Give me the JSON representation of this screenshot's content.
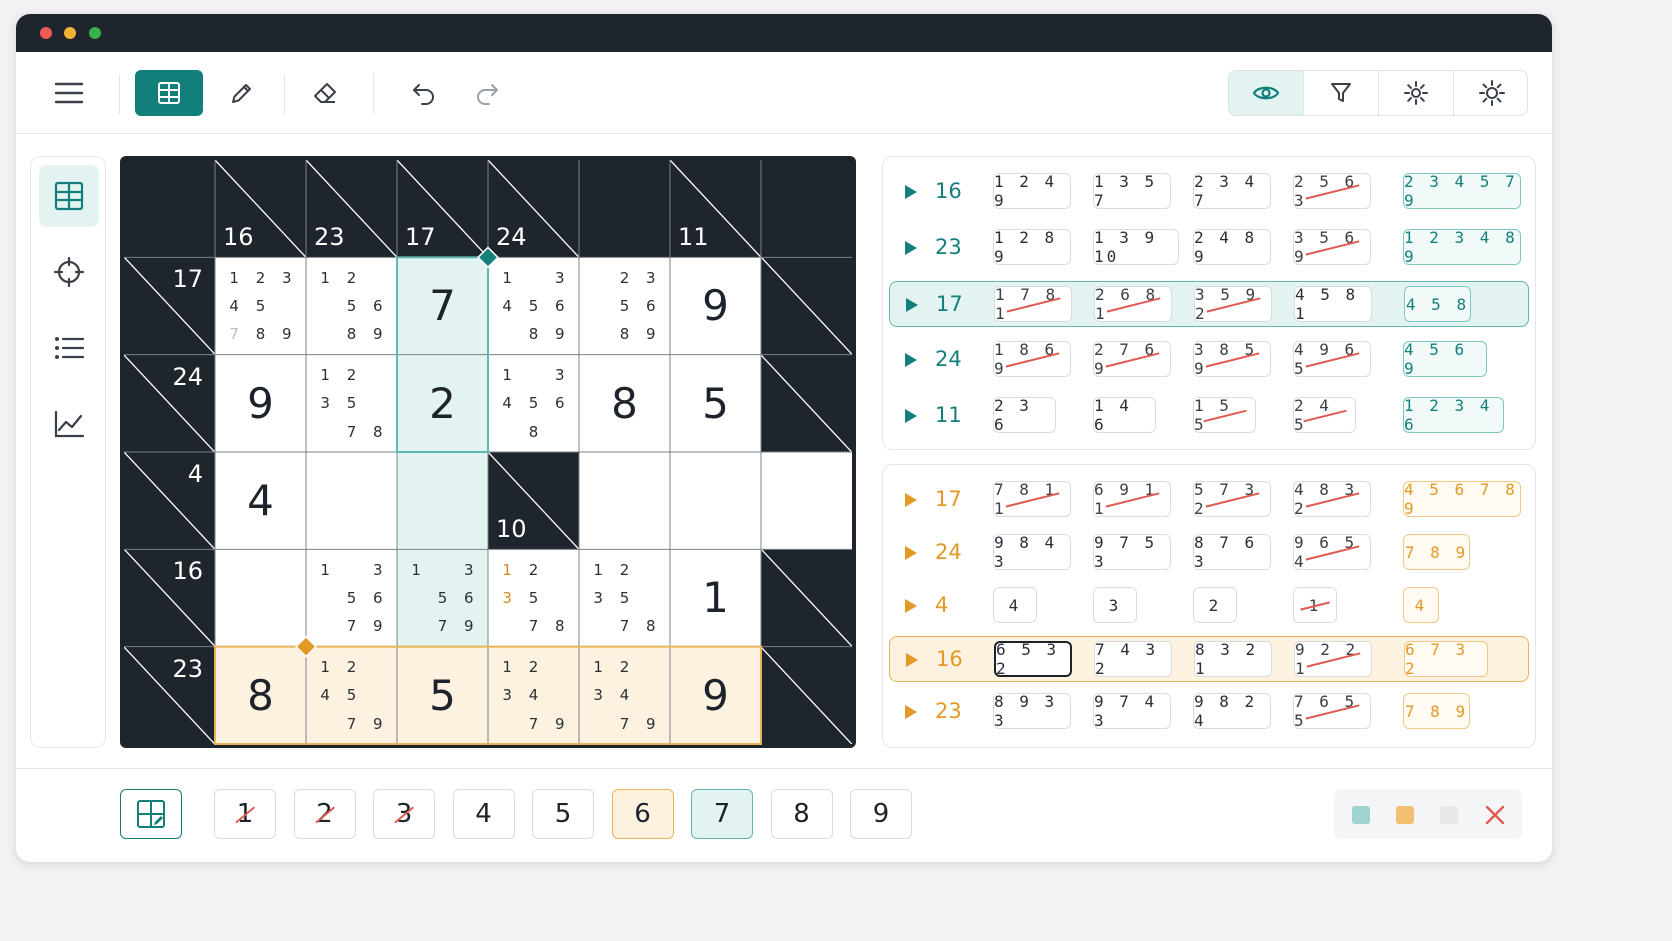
{
  "colors": {
    "teal": "#127f7b",
    "orange": "#e39a25",
    "dark": "#1f252c",
    "teal_light": "#e3f3f1",
    "orange_light": "#fdf1df",
    "strike": "#e05a50"
  },
  "toolbar": {
    "left_icons": [
      "menu-icon",
      "grid-icon",
      "pencil-icon",
      "eraser-icon",
      "undo-icon",
      "redo-icon"
    ],
    "right_icons": [
      "eye-icon",
      "filter-icon",
      "gear-icon",
      "sun-icon"
    ]
  },
  "sidebar": {
    "icons": [
      "grid-icon",
      "crosshair-icon",
      "list-icon",
      "chart-icon"
    ]
  },
  "board": {
    "cols": 8,
    "rows": 6,
    "cells": [
      [
        {
          "t": "b"
        },
        {
          "t": "c",
          "d": "16"
        },
        {
          "t": "c",
          "d": "23"
        },
        {
          "t": "c",
          "d": "17"
        },
        {
          "t": "c",
          "d": "24"
        },
        {
          "t": "b"
        },
        {
          "t": "c",
          "d": "11"
        },
        {
          "t": "b"
        }
      ],
      [
        {
          "t": "c",
          "r": "17"
        },
        {
          "t": "w",
          "n": [
            "1",
            "2",
            "3",
            "4",
            "5",
            "",
            "7",
            "8",
            "9"
          ],
          "dim": [
            6
          ]
        },
        {
          "t": "w",
          "n": [
            "1",
            "2",
            "",
            "",
            "5",
            "6",
            "",
            "8",
            "9"
          ]
        },
        {
          "t": "w",
          "h": "t",
          "v": "7"
        },
        {
          "t": "w",
          "n": [
            "1",
            "",
            "3",
            "4",
            "5",
            "6",
            "",
            "8",
            "9"
          ]
        },
        {
          "t": "w",
          "n": [
            "",
            "2",
            "3",
            "",
            "5",
            "6",
            "",
            "8",
            "9"
          ]
        },
        {
          "t": "w",
          "v": "9"
        },
        {
          "t": "c"
        }
      ],
      [
        {
          "t": "c",
          "r": "24"
        },
        {
          "t": "w",
          "v": "9"
        },
        {
          "t": "w",
          "n": [
            "1",
            "2",
            "",
            "3",
            "5",
            "",
            "",
            "7",
            "8"
          ]
        },
        {
          "t": "w",
          "h": "t",
          "v": "2"
        },
        {
          "t": "w",
          "n": [
            "1",
            "",
            "3",
            "4",
            "5",
            "6",
            "",
            "8",
            ""
          ]
        },
        {
          "t": "w",
          "v": "8"
        },
        {
          "t": "w",
          "v": "5"
        },
        {
          "t": "c"
        }
      ],
      [
        {
          "t": "c",
          "r": "4"
        },
        {
          "t": "w",
          "v": "4"
        },
        {
          "t": "w"
        },
        {
          "t": "w",
          "h": "t"
        },
        {
          "t": "c",
          "d": "10"
        },
        {
          "t": "w"
        },
        {
          "t": "w"
        },
        {
          "t": "w"
        }
      ],
      [
        {
          "t": "c",
          "r": "16"
        },
        {
          "t": "w"
        },
        {
          "t": "w",
          "n": [
            "1",
            "",
            "3",
            "",
            "5",
            "6",
            "",
            "7",
            "9"
          ]
        },
        {
          "t": "w",
          "h": "t",
          "n": [
            "1",
            "",
            "3",
            "",
            "5",
            "6",
            "",
            "7",
            "9"
          ]
        },
        {
          "t": "w",
          "n": [
            "1",
            "2",
            "",
            "3",
            "5",
            "",
            "",
            "7",
            "8"
          ],
          "hl": [
            0,
            3
          ]
        },
        {
          "t": "w",
          "n": [
            "1",
            "2",
            "",
            "3",
            "5",
            "",
            "",
            "7",
            "8"
          ]
        },
        {
          "t": "w",
          "v": "1"
        },
        {
          "t": "c"
        }
      ],
      [
        {
          "t": "c",
          "r": "23"
        },
        {
          "t": "w",
          "h": "o",
          "v": "8"
        },
        {
          "t": "w",
          "h": "o",
          "n": [
            "1",
            "2",
            "",
            "4",
            "5",
            "",
            "",
            "7",
            "9"
          ]
        },
        {
          "t": "w",
          "h": "o",
          "v": "5"
        },
        {
          "t": "w",
          "h": "o",
          "n": [
            "1",
            "2",
            "",
            "3",
            "4",
            "",
            "",
            "7",
            "9"
          ]
        },
        {
          "t": "w",
          "h": "o",
          "n": [
            "1",
            "2",
            "",
            "3",
            "4",
            "",
            "",
            "7",
            "9"
          ]
        },
        {
          "t": "w",
          "h": "o",
          "v": "9"
        },
        {
          "t": "c"
        }
      ]
    ]
  },
  "down_panel": {
    "rows": [
      {
        "sum": "16",
        "combos": [
          {
            "v": "1249"
          },
          {
            "v": "1357"
          },
          {
            "v": "2347"
          },
          {
            "v": "2563",
            "s": true
          }
        ],
        "result": "234579"
      },
      {
        "sum": "23",
        "combos": [
          {
            "v": "1289"
          },
          {
            "v": "13910"
          },
          {
            "v": "2489"
          },
          {
            "v": "3569",
            "s": true
          }
        ],
        "result": "123489"
      },
      {
        "sum": "17",
        "sel": true,
        "combos": [
          {
            "v": "1781",
            "s": true
          },
          {
            "v": "2681",
            "s": true
          },
          {
            "v": "3592",
            "s": true
          },
          {
            "v": "4581"
          }
        ],
        "result": "458"
      },
      {
        "sum": "24",
        "combos": [
          {
            "v": "1869",
            "s": true
          },
          {
            "v": "2769",
            "s": true
          },
          {
            "v": "3859",
            "s": true
          },
          {
            "v": "4965",
            "s": true
          }
        ],
        "result": "4569"
      },
      {
        "sum": "11",
        "combos": [
          {
            "v": "236"
          },
          {
            "v": "146"
          },
          {
            "v": "155",
            "s": true
          },
          {
            "v": "245",
            "s": true
          }
        ],
        "result": "12346"
      }
    ]
  },
  "across_panel": {
    "rows": [
      {
        "sum": "17",
        "combos": [
          {
            "v": "7811",
            "s": true
          },
          {
            "v": "6911",
            "s": true
          },
          {
            "v": "5732",
            "s": true
          },
          {
            "v": "4832",
            "s": true
          }
        ],
        "result": "456789"
      },
      {
        "sum": "24",
        "combos": [
          {
            "v": "9843"
          },
          {
            "v": "9753"
          },
          {
            "v": "8763"
          },
          {
            "v": "9654",
            "s": true
          }
        ],
        "result": "789"
      },
      {
        "sum": "4",
        "combos": [
          {
            "v": "4"
          },
          {
            "v": "3"
          },
          {
            "v": "2"
          },
          {
            "v": "1",
            "s": true
          }
        ],
        "result": "4"
      },
      {
        "sum": "16",
        "sel": true,
        "combos": [
          {
            "v": "6532",
            "b": true
          },
          {
            "v": "7432"
          },
          {
            "v": "8321"
          },
          {
            "v": "9221",
            "s": true
          }
        ],
        "result": "6732"
      },
      {
        "sum": "23",
        "combos": [
          {
            "v": "8933"
          },
          {
            "v": "9743"
          },
          {
            "v": "9824"
          },
          {
            "v": "7655",
            "s": true
          }
        ],
        "result": "789"
      }
    ]
  },
  "numpad": {
    "keys": [
      {
        "label": "1",
        "strike": true
      },
      {
        "label": "2",
        "strike": true
      },
      {
        "label": "3",
        "strike": true
      },
      {
        "label": "4"
      },
      {
        "label": "5"
      },
      {
        "label": "6",
        "state": "orange"
      },
      {
        "label": "7",
        "state": "teal"
      },
      {
        "label": "8"
      },
      {
        "label": "9"
      }
    ],
    "tool_icon": "grid-pencil-icon"
  },
  "swatches": {
    "colors": [
      "#9fd3cf",
      "#f2c06e",
      "#e6e8ea"
    ],
    "close_icon": "close-icon"
  }
}
